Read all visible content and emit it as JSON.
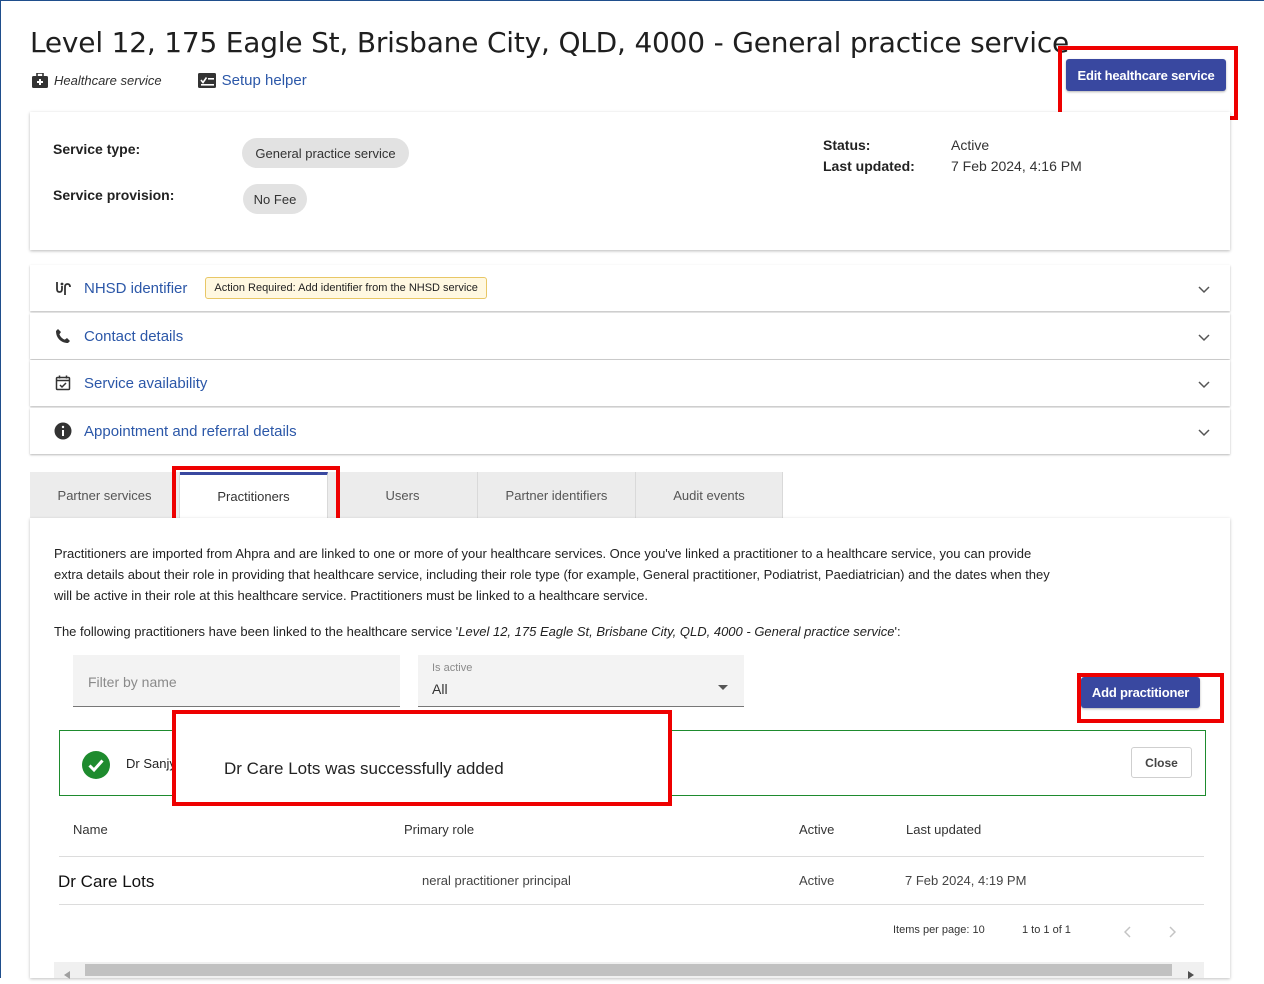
{
  "page": {
    "title": "Level 12, 175 Eagle St, Brisbane City, QLD, 4000 - General practice service",
    "type_label": "Healthcare service",
    "setup_helper": "Setup helper",
    "edit_button": "Edit healthcare service"
  },
  "summary": {
    "service_type_label": "Service type:",
    "service_type_value": "General practice service",
    "service_provision_label": "Service provision:",
    "service_provision_value": "No Fee",
    "status_label": "Status:",
    "status_value": "Active",
    "last_updated_label": "Last updated:",
    "last_updated_value": "7 Feb 2024, 4:16 PM"
  },
  "accordion": {
    "nhsd": "NHSD identifier",
    "nhsd_badge": "Action Required: Add identifier from the NHSD service",
    "contact": "Contact details",
    "availability": "Service availability",
    "appointment": "Appointment and referral details"
  },
  "tabs": {
    "partner_services": "Partner services",
    "practitioners": "Practitioners",
    "users": "Users",
    "partner_identifiers": "Partner identifiers",
    "audit_events": "Audit events"
  },
  "practitioners": {
    "intro_line1": "Practitioners are imported from Ahpra and are linked to one or more of your healthcare services. Once you've linked a practitioner to a healthcare service, you can provide",
    "intro_line2": "extra details about their role in providing that healthcare service, including their role type (for example, General practitioner, Podiatrist, Paediatrician) and the dates when they",
    "intro_line3": "will be active in their role at this healthcare service. Practitioners must be linked to a healthcare service.",
    "linked_prefix": "The following practitioners have been linked to the healthcare service '",
    "linked_service": "Level 12, 175 Eagle St, Brisbane City, QLD, 4000 - General practice service",
    "linked_suffix": "':",
    "filter_placeholder": "Filter by name",
    "is_active_label": "Is active",
    "is_active_value": "All",
    "add_button": "Add practitioner"
  },
  "alert": {
    "underlying_text": "Dr Sanjya '",
    "overlay_message": "Dr Care Lots was successfully added",
    "close": "Close"
  },
  "table": {
    "headers": {
      "name": "Name",
      "primary_role": "Primary role",
      "active": "Active",
      "last_updated": "Last updated"
    },
    "rows": [
      {
        "name": "Dr Care Lots",
        "primary_role": "neral practitioner principal",
        "active": "Active",
        "last_updated": "7 Feb 2024, 4:19 PM"
      }
    ]
  },
  "paginator": {
    "items_per_page": "Items per page: 10",
    "range": "1 to 1 of 1"
  },
  "colors": {
    "primary": "#3948a0",
    "link": "#2b57a8",
    "highlight": "#ee0000",
    "success": "#1e8b2e"
  }
}
